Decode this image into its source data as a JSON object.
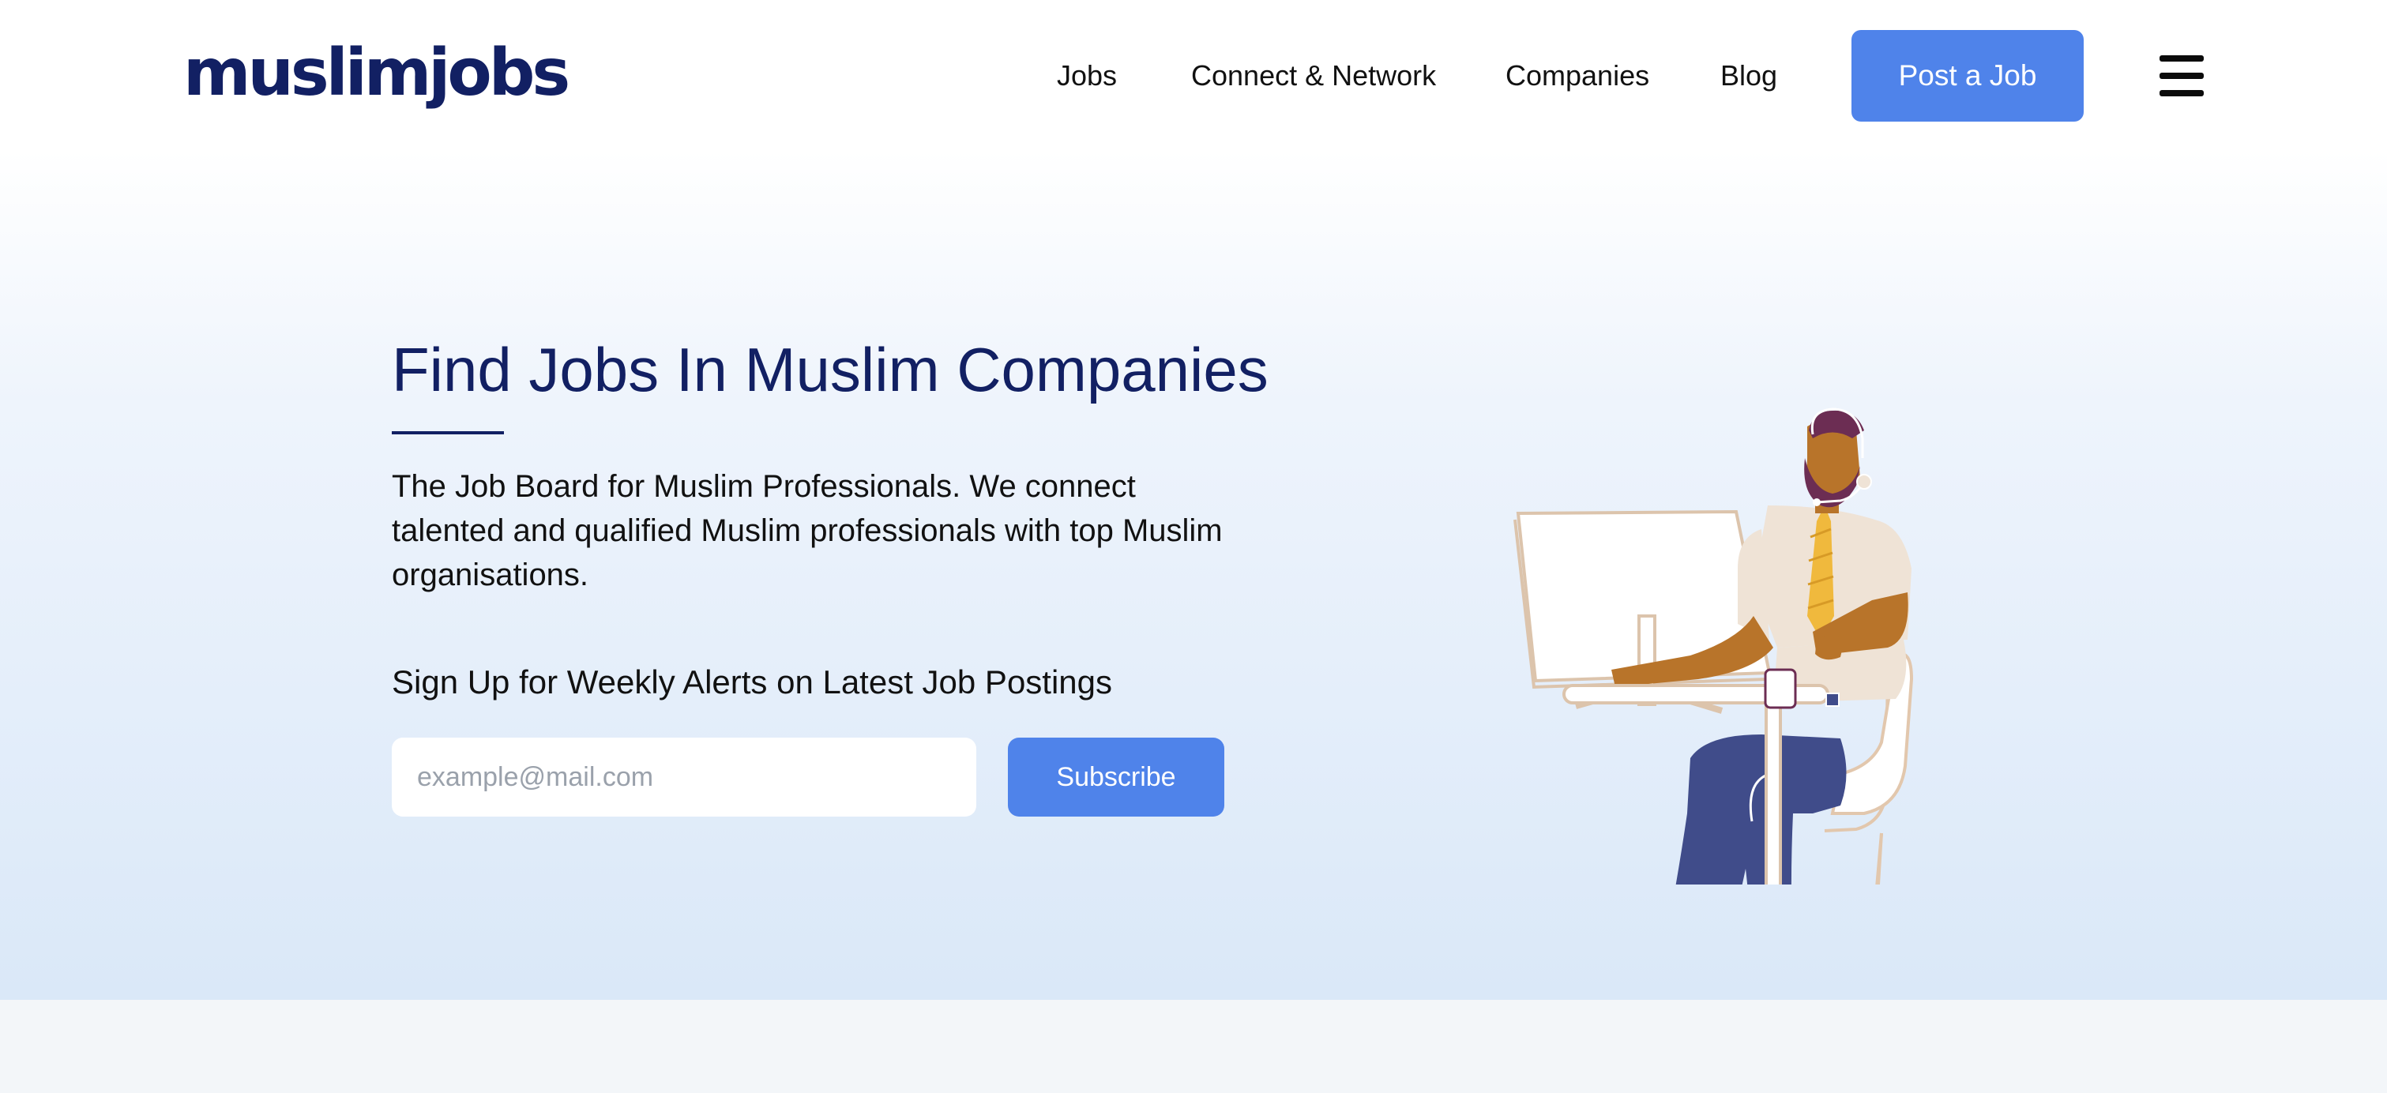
{
  "header": {
    "logo": "muslimjobs",
    "nav": [
      {
        "label": "Jobs"
      },
      {
        "label": "Connect & Network"
      },
      {
        "label": "Companies"
      },
      {
        "label": "Blog"
      }
    ],
    "post_job_label": "Post a Job",
    "menu_icon": "hamburger-menu-icon"
  },
  "hero": {
    "title": "Find Jobs In Muslim Companies",
    "description": "The Job Board for Muslim Professionals. We connect talented and qualified Muslim professionals with top Muslim organisations.",
    "alert_label": "Sign Up for Weekly Alerts on Latest Job Postings",
    "email_placeholder": "example@mail.com",
    "subscribe_label": "Subscribe",
    "illustration": "man-at-desk-illustration"
  },
  "colors": {
    "brand_navy": "#122063",
    "accent_blue": "#4f83ea",
    "hero_gradient_bottom": "#dae8f8"
  }
}
